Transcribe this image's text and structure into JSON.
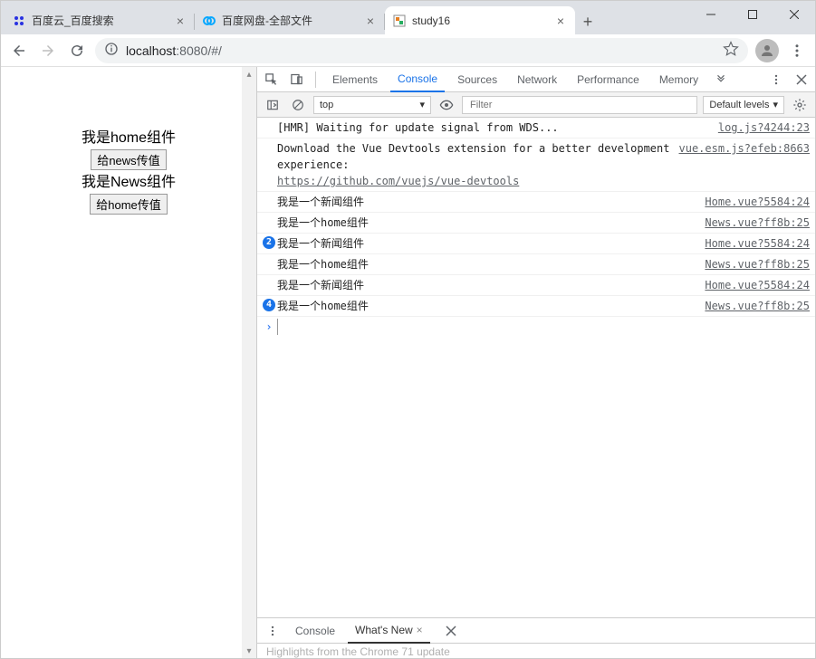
{
  "browser": {
    "tabs": [
      {
        "title": "百度云_百度搜索",
        "favicon": "baidu"
      },
      {
        "title": "百度网盘-全部文件",
        "favicon": "baidu-pan"
      },
      {
        "title": "study16",
        "favicon": "app"
      }
    ],
    "active_tab": 2,
    "url": {
      "host": "localhost",
      "port": ":8080",
      "path": "/#/"
    }
  },
  "page": {
    "home_label": "我是home组件",
    "news_btn": "给news传值",
    "news_label": "我是News组件",
    "home_btn": "给home传值"
  },
  "devtools": {
    "tabs": [
      "Elements",
      "Console",
      "Sources",
      "Network",
      "Performance",
      "Memory"
    ],
    "active_tab": "Console",
    "console": {
      "context": "top",
      "filter_placeholder": "Filter",
      "level": "Default levels",
      "logs": [
        {
          "badge": "",
          "msg": "[HMR] Waiting for update signal from WDS...",
          "src": "log.js?4244:23"
        },
        {
          "badge": "",
          "msg_html": "Download the Vue Devtools extension for a better development experience:",
          "link": "https://github.com/vuejs/vue-devtools",
          "src": "vue.esm.js?efeb:8663"
        },
        {
          "badge": "",
          "msg": "我是一个新闻组件",
          "src": "Home.vue?5584:24"
        },
        {
          "badge": "",
          "msg": "我是一个home组件",
          "src": "News.vue?ff8b:25"
        },
        {
          "badge": "2",
          "msg": "我是一个新闻组件",
          "src": "Home.vue?5584:24"
        },
        {
          "badge": "",
          "msg": "我是一个home组件",
          "src": "News.vue?ff8b:25"
        },
        {
          "badge": "",
          "msg": "我是一个新闻组件",
          "src": "Home.vue?5584:24"
        },
        {
          "badge": "4",
          "msg": "我是一个home组件",
          "src": "News.vue?ff8b:25"
        }
      ]
    },
    "drawer": {
      "tabs": [
        "Console",
        "What's New"
      ],
      "active": "What's New",
      "body": "Highlights from the Chrome 71 update"
    }
  }
}
